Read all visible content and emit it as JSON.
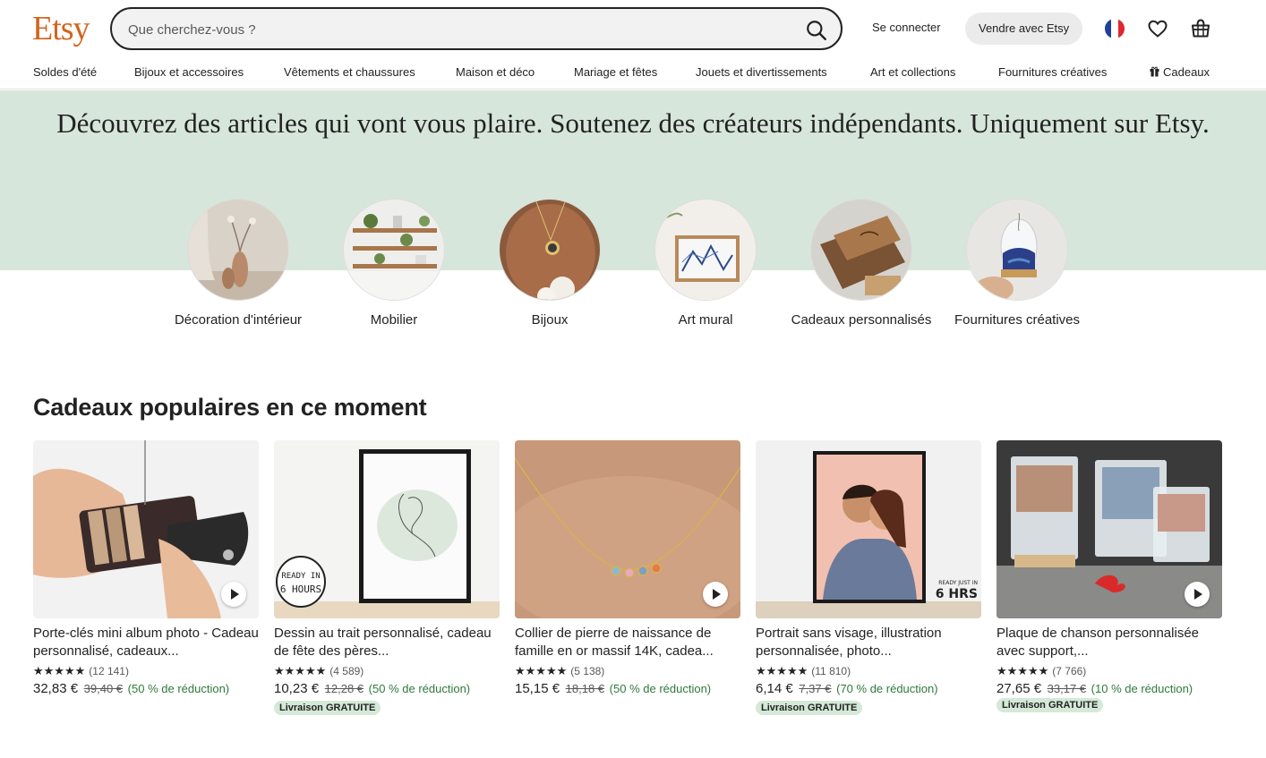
{
  "header": {
    "logo": "Etsy",
    "search_placeholder": "Que cherchez-vous ?",
    "signin": "Se connecter",
    "sell": "Vendre avec Etsy",
    "colors": {
      "brand": "#D5641C",
      "hero_bg": "#D7E6DA",
      "discount": "#2F7A3B"
    }
  },
  "nav": {
    "items": [
      "Soldes d'été",
      "Bijoux et accessoires",
      "Vêtements et chaussures",
      "Maison et déco",
      "Mariage et fêtes",
      "Jouets et divertissements",
      "Art et collections",
      "Fournitures créatives",
      "Cadeaux"
    ]
  },
  "hero": {
    "title": "Découvrez des articles qui vont vous plaire. Soutenez des créateurs indépendants. Uniquement sur Etsy."
  },
  "categories": [
    {
      "label": "Décoration d'intérieur"
    },
    {
      "label": "Mobilier"
    },
    {
      "label": "Bijoux"
    },
    {
      "label": "Art mural"
    },
    {
      "label": "Cadeaux personnalisés"
    },
    {
      "label": "Fournitures créatives"
    }
  ],
  "section": {
    "title": "Cadeaux populaires en ce moment"
  },
  "products": [
    {
      "title": "Porte-clés mini album photo - Cadeau personnalisé, cadeaux...",
      "stars": "★★★★★",
      "reviews": "(12 141)",
      "price": "32,83 €",
      "old_price": "39,40 €",
      "discount": "(50 % de réduction)",
      "badge": ""
    },
    {
      "title": "Dessin au trait personnalisé, cadeau de fête des pères...",
      "stars": "★★★★★",
      "reviews": "(4 589)",
      "price": "10,23 €",
      "old_price": "12,28 €",
      "discount": "(50 % de réduction)",
      "badge": "Livraison GRATUITE"
    },
    {
      "title": "Collier de pierre de naissance de famille en or massif 14K, cadea...",
      "stars": "★★★★★",
      "reviews": "(5 138)",
      "price": "15,15 €",
      "old_price": "18,18 €",
      "discount": "(50 % de réduction)",
      "badge": ""
    },
    {
      "title": "Portrait sans visage, illustration personnalisée, photo...",
      "stars": "★★★★★",
      "reviews": "(11 810)",
      "price": "6,14 €",
      "old_price": "7,37 €",
      "discount": "(70 % de réduction)",
      "badge": "Livraison GRATUITE"
    },
    {
      "title": "Plaque de chanson personnalisée avec support,...",
      "stars": "★★★★★",
      "reviews": "(7 766)",
      "price": "27,65 €",
      "old_price": "33,17 €",
      "discount": "(10 % de réduction)",
      "badge": "Livraison GRATUITE"
    }
  ],
  "image_text": {
    "ready_in": "READY IN",
    "hours": "6 HOURS",
    "ready_just_in": "READY JUST IN",
    "hrs": "6 HRS"
  }
}
